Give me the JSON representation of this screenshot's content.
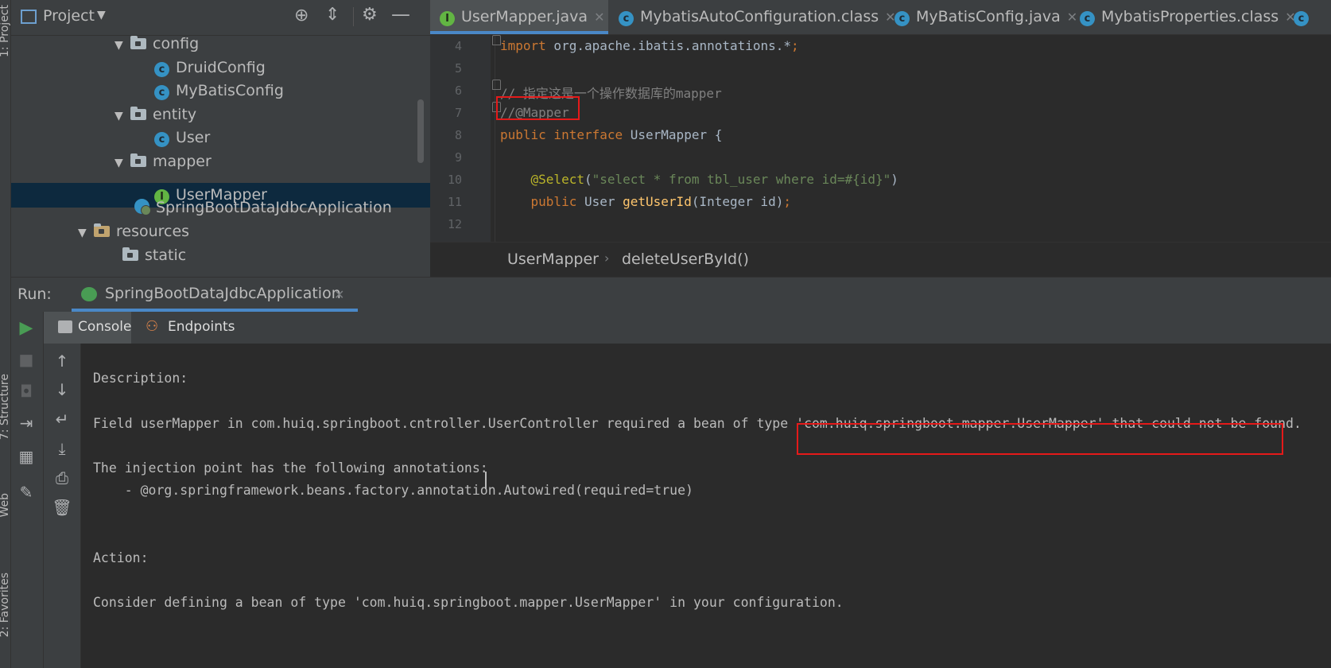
{
  "left_stripe": {
    "labels": [
      "1: Project",
      "7: Structure",
      "Web",
      "2: Favorites"
    ]
  },
  "project": {
    "title": "Project",
    "tree": [
      {
        "label": "config",
        "kind": "folder",
        "expanded": true
      },
      {
        "label": "DruidConfig",
        "kind": "class"
      },
      {
        "label": "MyBatisConfig",
        "kind": "class"
      },
      {
        "label": "entity",
        "kind": "folder",
        "expanded": true
      },
      {
        "label": "User",
        "kind": "class"
      },
      {
        "label": "mapper",
        "kind": "folder",
        "expanded": true
      },
      {
        "label": "UserMapper",
        "kind": "interface",
        "selected": true
      },
      {
        "label": "SpringBootDataJdbcApplication",
        "kind": "spring-class"
      },
      {
        "label": "resources",
        "kind": "resources-folder",
        "expanded": true
      },
      {
        "label": "static",
        "kind": "folder"
      }
    ]
  },
  "editor": {
    "tabs": [
      {
        "label": "UserMapper.java",
        "kind": "interface",
        "active": true
      },
      {
        "label": "MybatisAutoConfiguration.class",
        "kind": "class"
      },
      {
        "label": "MyBatisConfig.java",
        "kind": "class"
      },
      {
        "label": "MybatisProperties.class",
        "kind": "class"
      },
      {
        "label": "",
        "kind": "class"
      }
    ],
    "lines": [
      {
        "n": "4",
        "tokens": [
          {
            "t": "import",
            "c": "kw"
          },
          {
            "t": " org.apache.ibatis.annotations.*",
            "c": ""
          },
          {
            "t": ";",
            "c": "kw"
          }
        ]
      },
      {
        "n": "5",
        "tokens": []
      },
      {
        "n": "6",
        "tokens": [
          {
            "t": "// 指定这是一个操作数据库的mapper",
            "c": "cm"
          }
        ]
      },
      {
        "n": "7",
        "tokens": [
          {
            "t": "//@Mapper",
            "c": "cm"
          }
        ]
      },
      {
        "n": "8",
        "tokens": [
          {
            "t": "public interface",
            "c": "kw"
          },
          {
            "t": " UserMapper {",
            "c": ""
          }
        ]
      },
      {
        "n": "9",
        "tokens": []
      },
      {
        "n": "10",
        "tokens": [
          {
            "t": "    ",
            "c": ""
          },
          {
            "t": "@Select",
            "c": "an"
          },
          {
            "t": "(",
            "c": ""
          },
          {
            "t": "\"select * from tbl_user where id=#{id}\"",
            "c": "st"
          },
          {
            "t": ")",
            "c": ""
          }
        ]
      },
      {
        "n": "11",
        "tokens": [
          {
            "t": "    public",
            "c": "kw"
          },
          {
            "t": " User ",
            "c": ""
          },
          {
            "t": "getUserId",
            "c": "fn"
          },
          {
            "t": "(Integer id)",
            "c": ""
          },
          {
            "t": ";",
            "c": "kw"
          }
        ]
      },
      {
        "n": "12",
        "tokens": []
      }
    ],
    "breadcrumb": [
      "UserMapper",
      "deleteUserById()"
    ]
  },
  "run": {
    "label": "Run:",
    "config_name": "SpringBootDataJdbcApplication",
    "subtabs": [
      "Console",
      "Endpoints"
    ],
    "console_lines": [
      "***************************",
      "",
      "Description:",
      "",
      "Field userMapper in com.huiq.springboot.cntroller.UserController required a bean of type 'com.huiq.springboot.mapper.UserMapper' that could not be found.",
      "",
      "The injection point has the following annotations:",
      "\t- @org.springframework.beans.factory.annotation.Autowired(required=true)",
      "",
      "",
      "Action:",
      "",
      "Consider defining a bean of type 'com.huiq.springboot.mapper.UserMapper' in your configuration."
    ]
  },
  "colors": {
    "highlight": "#e51a1a",
    "accent": "#4a88c7",
    "run_green": "#499c54"
  }
}
